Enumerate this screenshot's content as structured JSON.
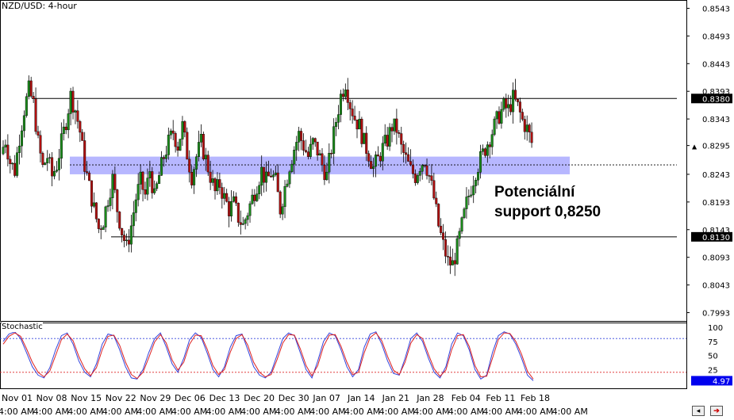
{
  "window": {
    "title": "NZD/USD: 4-hour",
    "indicator_label": "Stochastic",
    "annotation_line1": "Potenciální",
    "annotation_line2": "support 0,8250",
    "ctrl_scroll_icon": "scroll-left-icon",
    "ctrl_arrow_icon": "arrow-right-icon"
  },
  "colors": {
    "bull": "#1a8a1a",
    "bear": "#b01010",
    "zone": "#9999ff",
    "stoch_main": "#3344dd",
    "stoch_signal": "#dd2222",
    "stoch_upper_line": "#3344dd",
    "stoch_lower_line": "#dd2222",
    "value_box": "#0000ee"
  },
  "chart_data": [
    {
      "type": "candlestick",
      "title": "NZD/USD: 4-hour",
      "y_axis_ticks": [
        "0.8543",
        "0.8493",
        "0.8443",
        "0.8393",
        "0.8343",
        "0.8295",
        "0.8243",
        "0.8193",
        "0.8143",
        "0.8093",
        "0.8043",
        "0.7993"
      ],
      "ylim": [
        0.7978,
        0.8558
      ],
      "x_axis_dates": [
        "Nov 01",
        "Nov 08",
        "Nov 15",
        "Nov 22",
        "Nov 29",
        "Dec 06",
        "Dec 13",
        "Dec 20",
        "Dec 30",
        "Jan 07",
        "Jan 14",
        "Jan 21",
        "Jan 28",
        "Feb 04",
        "Feb 11",
        "Feb 18"
      ],
      "x_axis_times": [
        "4:00 AM",
        "4:00 AM",
        "4:00 AM",
        "4:00 AM",
        "4:00 AM",
        "4:00 AM",
        "4:00 AM",
        "4:00 AM",
        "4:00 AM",
        "4:00 AM",
        "4:00 AM",
        "4:00 AM",
        "4:00 AM",
        "4:00 AM",
        "4:00 AM",
        "4:00 AM",
        "4:00 AM"
      ],
      "price_path": [
        0.828,
        0.8305,
        0.8265,
        0.825,
        0.831,
        0.836,
        0.8395,
        0.837,
        0.83,
        0.8255,
        0.8275,
        0.824,
        0.826,
        0.83,
        0.834,
        0.8385,
        0.836,
        0.832,
        0.826,
        0.822,
        0.818,
        0.8145,
        0.816,
        0.82,
        0.8235,
        0.818,
        0.814,
        0.811,
        0.815,
        0.82,
        0.823,
        0.8205,
        0.825,
        0.82,
        0.824,
        0.8275,
        0.83,
        0.832,
        0.8295,
        0.833,
        0.828,
        0.824,
        0.8275,
        0.83,
        0.827,
        0.824,
        0.821,
        0.8225,
        0.82,
        0.818,
        0.819,
        0.8165,
        0.815,
        0.8175,
        0.82,
        0.8225,
        0.825,
        0.823,
        0.8245,
        0.823,
        0.818,
        0.822,
        0.826,
        0.829,
        0.8315,
        0.8295,
        0.8275,
        0.83,
        0.8285,
        0.826,
        0.824,
        0.829,
        0.834,
        0.8385,
        0.841,
        0.837,
        0.8345,
        0.833,
        0.83,
        0.828,
        0.8255,
        0.827,
        0.829,
        0.8305,
        0.833,
        0.8325,
        0.829,
        0.827,
        0.825,
        0.824,
        0.826,
        0.827,
        0.824,
        0.82,
        0.815,
        0.8115,
        0.8085,
        0.808,
        0.811,
        0.815,
        0.819,
        0.822,
        0.825,
        0.827,
        0.829,
        0.831,
        0.833,
        0.835,
        0.8365,
        0.836,
        0.838,
        0.8365,
        0.834,
        0.8325,
        0.83
      ],
      "horizontal_lines": [
        0.838,
        0.813
      ],
      "dashed_line": 0.826,
      "support_zone": [
        0.8243,
        0.8275
      ],
      "price_labels": [
        {
          "text": "0.8380",
          "value": 0.838,
          "style": "box"
        },
        {
          "text": "0.8295",
          "value": 0.8295,
          "style": "current"
        },
        {
          "text": "0.8130",
          "value": 0.813,
          "style": "box"
        }
      ]
    },
    {
      "type": "line",
      "title": "Stochastic",
      "y_axis_ticks": [
        "100",
        "75",
        "50",
        "25",
        "0"
      ],
      "ylim": [
        0,
        100
      ],
      "level_lines": [
        80,
        20
      ],
      "current_value": "4.97",
      "series": [
        {
          "name": "",
          "values": [
            75,
            88,
            92,
            80,
            55,
            30,
            15,
            10,
            28,
            60,
            85,
            90,
            70,
            40,
            20,
            12,
            35,
            70,
            88,
            85,
            60,
            30,
            10,
            8,
            25,
            55,
            80,
            90,
            65,
            35,
            20,
            45,
            78,
            90,
            82,
            55,
            25,
            12,
            30,
            65,
            85,
            88,
            60,
            30,
            15,
            10,
            20,
            50,
            80,
            90,
            85,
            55,
            25,
            10,
            40,
            75,
            90,
            85,
            60,
            30,
            12,
            25,
            65,
            88,
            92,
            70,
            40,
            18,
            15,
            45,
            80,
            90,
            75,
            45,
            20,
            10,
            30,
            70,
            90,
            85,
            60,
            25,
            8,
            15,
            55,
            85,
            92,
            88,
            70,
            45,
            15,
            5
          ]
        },
        {
          "name": "",
          "values": [
            70,
            84,
            90,
            84,
            62,
            38,
            20,
            12,
            22,
            50,
            78,
            88,
            76,
            48,
            26,
            14,
            28,
            60,
            84,
            86,
            68,
            38,
            16,
            9,
            20,
            46,
            74,
            87,
            72,
            42,
            24,
            38,
            70,
            86,
            85,
            62,
            32,
            16,
            25,
            56,
            80,
            87,
            68,
            38,
            20,
            12,
            16,
            42,
            72,
            87,
            86,
            62,
            32,
            14,
            32,
            66,
            86,
            87,
            66,
            38,
            16,
            20,
            55,
            82,
            90,
            76,
            48,
            24,
            16,
            38,
            72,
            87,
            80,
            52,
            26,
            13,
            24,
            60,
            85,
            87,
            66,
            32,
            12,
            13,
            45,
            78,
            90,
            89,
            75,
            52,
            22,
            8
          ]
        }
      ]
    }
  ]
}
